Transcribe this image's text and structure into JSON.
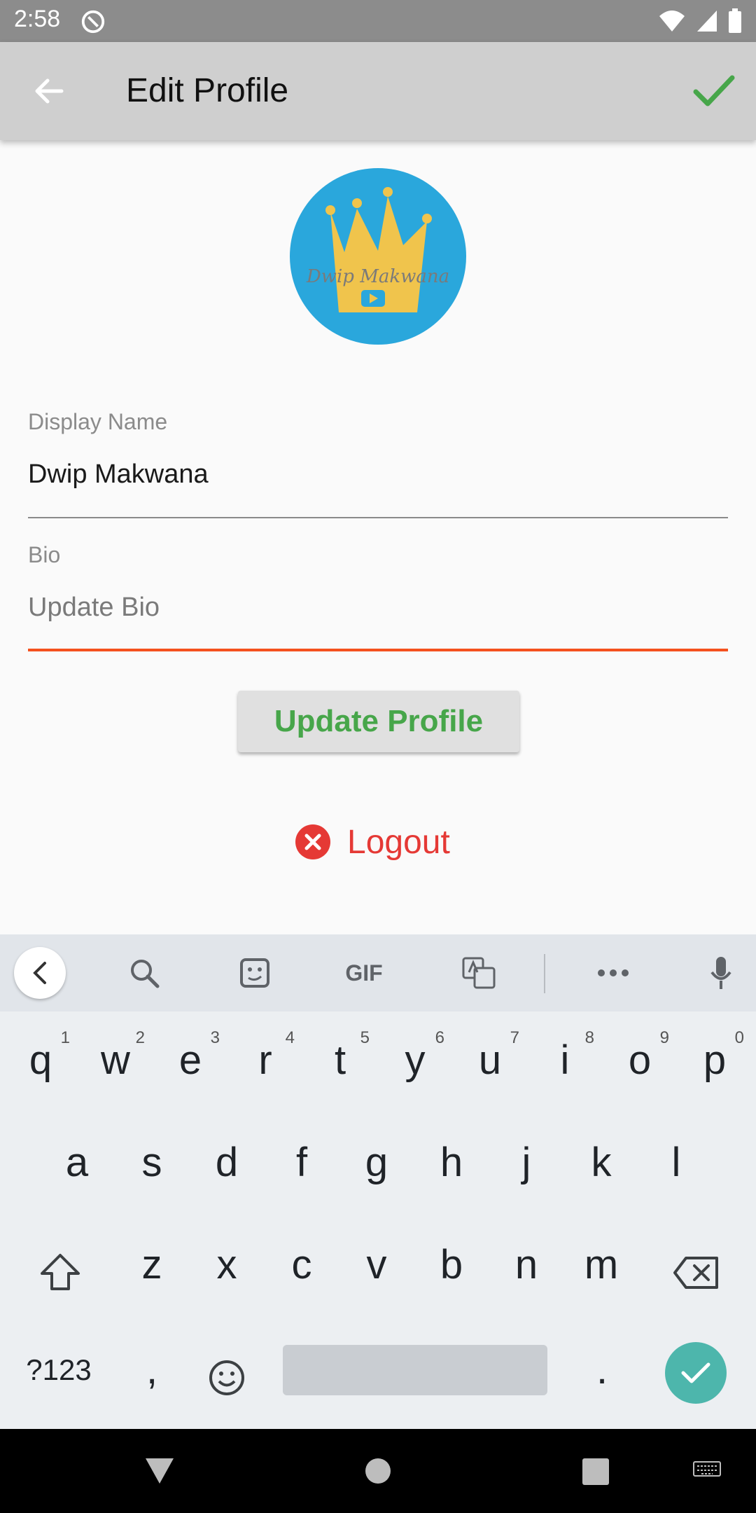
{
  "status": {
    "time": "2:58"
  },
  "appbar": {
    "title": "Edit Profile"
  },
  "avatar": {
    "text": "Dwip Makwana"
  },
  "form": {
    "display_name_label": "Display Name",
    "display_name_value": "Dwip Makwana",
    "bio_label": "Bio",
    "bio_placeholder": "Update Bio"
  },
  "actions": {
    "update_label": "Update Profile",
    "logout_label": "Logout"
  },
  "keyboard": {
    "toolbar_gif": "GIF",
    "row1": [
      {
        "k": "q",
        "n": "1"
      },
      {
        "k": "w",
        "n": "2"
      },
      {
        "k": "e",
        "n": "3"
      },
      {
        "k": "r",
        "n": "4"
      },
      {
        "k": "t",
        "n": "5"
      },
      {
        "k": "y",
        "n": "6"
      },
      {
        "k": "u",
        "n": "7"
      },
      {
        "k": "i",
        "n": "8"
      },
      {
        "k": "o",
        "n": "9"
      },
      {
        "k": "p",
        "n": "0"
      }
    ],
    "row2": [
      "a",
      "s",
      "d",
      "f",
      "g",
      "h",
      "j",
      "k",
      "l"
    ],
    "row3": [
      "z",
      "x",
      "c",
      "v",
      "b",
      "n",
      "m"
    ],
    "symbols_label": "?123",
    "comma": ",",
    "period": "."
  },
  "colors": {
    "accent": "#f4511e",
    "success": "#47a64a",
    "danger": "#e53935",
    "keyboard_enter": "#4db6ac"
  }
}
